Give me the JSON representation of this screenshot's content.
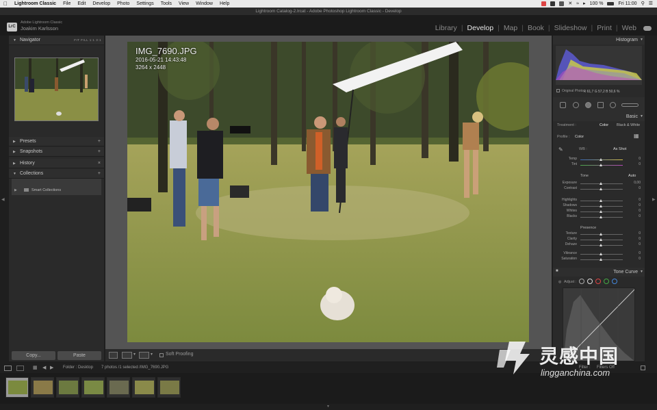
{
  "menubar": {
    "app": "Lightroom Classic",
    "items": [
      "File",
      "Edit",
      "Develop",
      "Photo",
      "Settings",
      "Tools",
      "View",
      "Window",
      "Help"
    ],
    "battery": "100 %",
    "clock": "Fri 11:00"
  },
  "titlebar": {
    "title": "Lightroom Catalog-2.lrcat - Adobe Photoshop Lightroom Classic - Develop"
  },
  "identity": {
    "badge": "LrC",
    "app_sub": "Adobe Lightroom Classic",
    "user": "Joakim Karlsson"
  },
  "modules": [
    "Library",
    "Develop",
    "Map",
    "Book",
    "Slideshow",
    "Print",
    "Web"
  ],
  "active_module": "Develop",
  "left_panel": {
    "navigator": "Navigator",
    "zoom_options": "FIT  FILL  1:1  3:1",
    "presets": "Presets",
    "snapshots": "Snapshots",
    "history": "History",
    "collections": "Collections",
    "smart_collections": "Smart Collections",
    "copy_label": "Copy...",
    "paste_label": "Paste"
  },
  "photo": {
    "filename": "IMG_7690.JPG",
    "datetime": "2016-05-21 14:43:48",
    "dimensions": "3264 x 2448"
  },
  "toolbar": {
    "soft_proofing": "Soft Proofing"
  },
  "right_panel": {
    "histogram": "Histogram",
    "hist_values": "R 61,7  G 57,2  B 50,6 %",
    "original_photo": "Original Photo",
    "basic": "Basic",
    "treatment_label": "Treatment :",
    "treatment_color": "Color",
    "treatment_bw": "Black & White",
    "profile_label": "Profile :",
    "profile_value": "Color",
    "wb_label": "WB :",
    "wb_value": "As Shot",
    "tone_label": "Tone",
    "auto_label": "Auto",
    "presence_label": "Presence",
    "tone_curve": "Tone Curve",
    "adjust_label": "Adjust :",
    "rows": [
      {
        "label": "Temp",
        "value": "0"
      },
      {
        "label": "Tint",
        "value": "0"
      },
      {
        "label": "Exposure",
        "value": "0,00"
      },
      {
        "label": "Contrast",
        "value": "0"
      },
      {
        "label": "Highlights",
        "value": "0"
      },
      {
        "label": "Shadows",
        "value": "0"
      },
      {
        "label": "Whites",
        "value": "0"
      },
      {
        "label": "Blacks",
        "value": "0"
      },
      {
        "label": "Texture",
        "value": "0"
      },
      {
        "label": "Clarity",
        "value": "0"
      },
      {
        "label": "Dehaze",
        "value": "0"
      },
      {
        "label": "Vibrance",
        "value": "0"
      },
      {
        "label": "Saturation",
        "value": "0"
      }
    ]
  },
  "filmstrip": {
    "source_label": "Folder : Desktop",
    "count_label": "7 photos /1 selected /IMG_7690.JPG",
    "filter_label": "Filter :",
    "filter_value": "Filters Off",
    "thumb_count": 7
  },
  "watermark": {
    "cn": "灵感中国",
    "en": "lingganchina.com"
  },
  "colors": {
    "accent": "#e8e8e8",
    "panel": "#2a2a2a",
    "canvas": "#545454"
  }
}
